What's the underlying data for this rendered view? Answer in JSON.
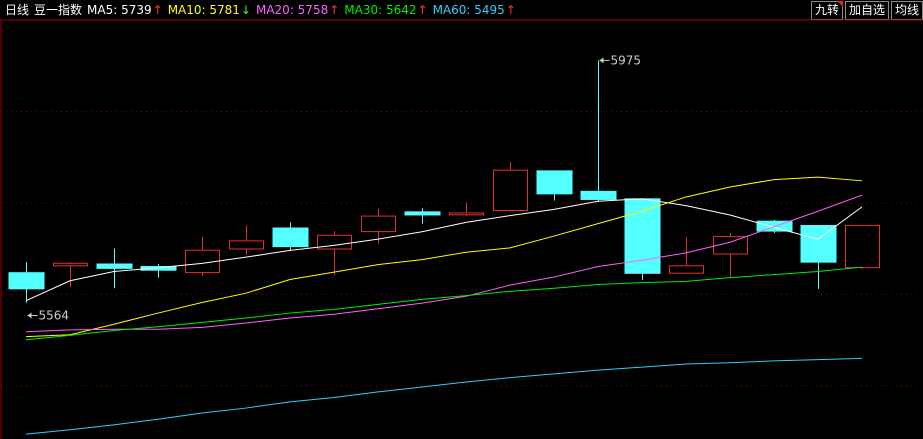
{
  "header": {
    "period": "日线",
    "name": "豆一指数",
    "mas": [
      {
        "label": "MA5: 5739",
        "arrow": "↑",
        "arrow_color": "#ff3030",
        "color": "#ffffff"
      },
      {
        "label": "MA10: 5781",
        "arrow": "↓",
        "arrow_color": "#30ff30",
        "color": "#ffff00"
      },
      {
        "label": "MA20: 5758",
        "arrow": "↑",
        "arrow_color": "#ff3030",
        "color": "#ff60ff"
      },
      {
        "label": "MA30: 5642",
        "arrow": "↑",
        "arrow_color": "#ff3030",
        "color": "#00ee00"
      },
      {
        "label": "MA60: 5495",
        "arrow": "↑",
        "arrow_color": "#ff3030",
        "color": "#33ccff"
      }
    ]
  },
  "buttons": [
    "九转",
    "加自选",
    "均线"
  ],
  "colors": {
    "background": "#000000",
    "up": "#e03030",
    "down": "#54ffff",
    "grid": "#800000",
    "axis": "#a00000"
  },
  "chart_data": {
    "type": "candlestick",
    "ylim": [
      5370,
      6040
    ],
    "annotations": [
      {
        "text": "5975",
        "value": 5975,
        "candle": 13
      },
      {
        "text": "5564",
        "value": 5564,
        "candle": 0
      }
    ],
    "candles": [
      {
        "o": 5633,
        "h": 5650,
        "l": 5585,
        "c": 5607
      },
      {
        "o": 5645,
        "h": 5650,
        "l": 5610,
        "c": 5649
      },
      {
        "o": 5647,
        "h": 5672,
        "l": 5608,
        "c": 5640
      },
      {
        "o": 5643,
        "h": 5647,
        "l": 5625,
        "c": 5637
      },
      {
        "o": 5634,
        "h": 5691,
        "l": 5628,
        "c": 5670
      },
      {
        "o": 5672,
        "h": 5709,
        "l": 5662,
        "c": 5685
      },
      {
        "o": 5705,
        "h": 5714,
        "l": 5668,
        "c": 5675
      },
      {
        "o": 5672,
        "h": 5700,
        "l": 5629,
        "c": 5694
      },
      {
        "o": 5700,
        "h": 5736,
        "l": 5680,
        "c": 5725
      },
      {
        "o": 5731,
        "h": 5737,
        "l": 5712,
        "c": 5726
      },
      {
        "o": 5727,
        "h": 5746,
        "l": 5724,
        "c": 5730
      },
      {
        "o": 5734,
        "h": 5811,
        "l": 5731,
        "c": 5799
      },
      {
        "o": 5797,
        "h": 5797,
        "l": 5749,
        "c": 5760
      },
      {
        "o": 5764,
        "h": 5975,
        "l": 5747,
        "c": 5751
      },
      {
        "o": 5752,
        "h": 5752,
        "l": 5621,
        "c": 5632
      },
      {
        "o": 5633,
        "h": 5690,
        "l": 5633,
        "c": 5645
      },
      {
        "o": 5664,
        "h": 5697,
        "l": 5625,
        "c": 5692
      },
      {
        "o": 5716,
        "h": 5718,
        "l": 5697,
        "c": 5700
      },
      {
        "o": 5709,
        "h": 5709,
        "l": 5607,
        "c": 5650
      },
      {
        "o": 5642,
        "h": 5710,
        "l": 5639,
        "c": 5710
      }
    ],
    "ma": [
      {
        "name": "MA5",
        "color": "#ffffff",
        "values": [
          5588,
          5620,
          5635,
          5641,
          5648,
          5658,
          5669,
          5677,
          5687,
          5699,
          5714,
          5725,
          5735,
          5748,
          5752,
          5741,
          5726,
          5706,
          5687,
          5739
        ]
      },
      {
        "name": "MA10",
        "color": "#ffff00",
        "values": [
          5530,
          5533,
          5550,
          5568,
          5585,
          5600,
          5622,
          5634,
          5646,
          5654,
          5666,
          5673,
          5692,
          5712,
          5732,
          5755,
          5771,
          5783,
          5787,
          5781
        ]
      },
      {
        "name": "MA20",
        "color": "#ff60ff",
        "values": [
          5538,
          5541,
          5542,
          5542,
          5545,
          5552,
          5560,
          5566,
          5575,
          5584,
          5595,
          5613,
          5626,
          5643,
          5653,
          5665,
          5682,
          5707,
          5732,
          5758
        ]
      },
      {
        "name": "MA30",
        "color": "#00ee00",
        "values": [
          5525,
          5532,
          5540,
          5546,
          5553,
          5560,
          5568,
          5574,
          5582,
          5590,
          5596,
          5603,
          5608,
          5614,
          5617,
          5619,
          5625,
          5630,
          5635,
          5642
        ]
      },
      {
        "name": "MA60",
        "color": "#33ccff",
        "values": [
          5373,
          5380,
          5388,
          5397,
          5407,
          5415,
          5425,
          5432,
          5441,
          5449,
          5457,
          5464,
          5470,
          5476,
          5481,
          5486,
          5488,
          5491,
          5493,
          5495
        ]
      }
    ]
  }
}
